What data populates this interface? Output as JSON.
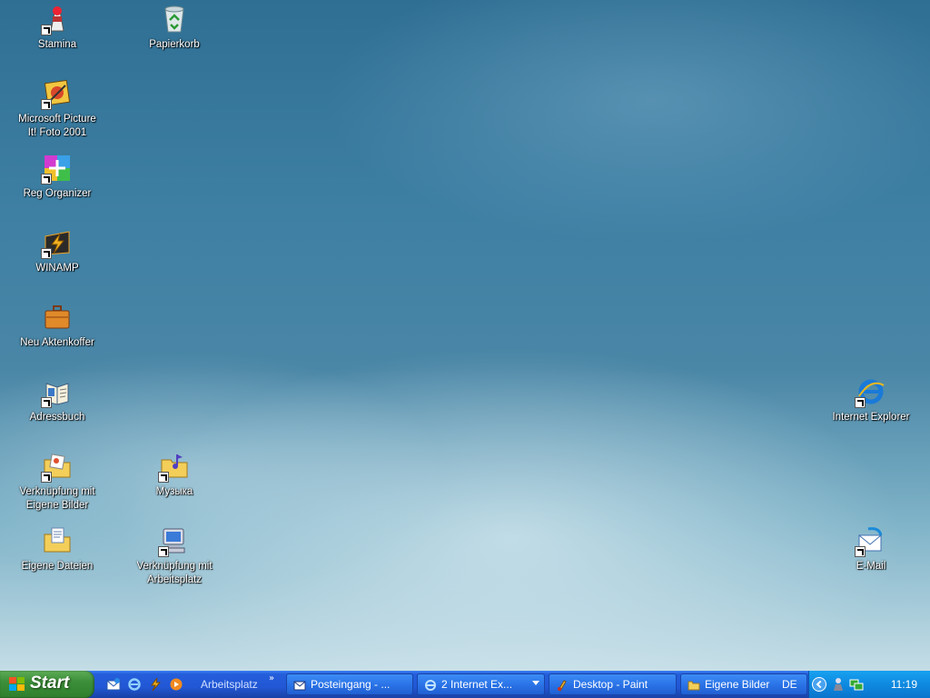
{
  "desktop": {
    "wallpaper": "underwater-scene",
    "icons": [
      {
        "label": "Stamina",
        "icon": "stamina-icon"
      },
      {
        "label": "Papierkorb",
        "icon": "recycle-bin-icon"
      },
      {
        "label": "Microsoft Picture It! Foto 2001",
        "icon": "picture-it-icon"
      },
      {
        "label": "Reg Organizer",
        "icon": "reg-organizer-icon"
      },
      {
        "label": "WINAMP",
        "icon": "winamp-icon"
      },
      {
        "label": "Neu Aktenkoffer",
        "icon": "briefcase-icon"
      },
      {
        "label": "Adressbuch",
        "icon": "address-book-icon"
      },
      {
        "label": "Verknüpfung mit Eigene Bilder",
        "icon": "my-pictures-folder-icon"
      },
      {
        "label": "Музыка",
        "icon": "music-folder-icon"
      },
      {
        "label": "Eigene Dateien",
        "icon": "my-documents-icon"
      },
      {
        "label": "Verknüpfung mit Arbeitsplatz",
        "icon": "my-computer-icon"
      },
      {
        "label": "Internet Explorer",
        "icon": "internet-explorer-icon"
      },
      {
        "label": "E-Mail",
        "icon": "email-icon"
      }
    ]
  },
  "taskbar": {
    "start_label": "Start",
    "quick_launch": {
      "label": "Arbeitsplatz",
      "more": "»",
      "icons": [
        "outlook-express-icon",
        "internet-explorer-icon",
        "winamp-icon",
        "media-player-icon"
      ]
    },
    "tasks": [
      {
        "label": "Posteingang - ...",
        "icon": "outlook-express-icon"
      },
      {
        "label": "2 Internet Ex...",
        "icon": "internet-explorer-icon"
      },
      {
        "label": "Desktop - Paint",
        "icon": "paint-icon"
      },
      {
        "label": "Eigene Bilder",
        "icon": "folder-icon"
      }
    ],
    "tray": {
      "language": "DE",
      "icons": [
        "show-hidden-icons-icon",
        "user-icon",
        "network-icon"
      ],
      "clock": "11:19"
    }
  },
  "colors": {
    "taskbar_blue": "#245edb",
    "start_green": "#3c8f3a",
    "tray_blue": "#0e8ae0"
  }
}
